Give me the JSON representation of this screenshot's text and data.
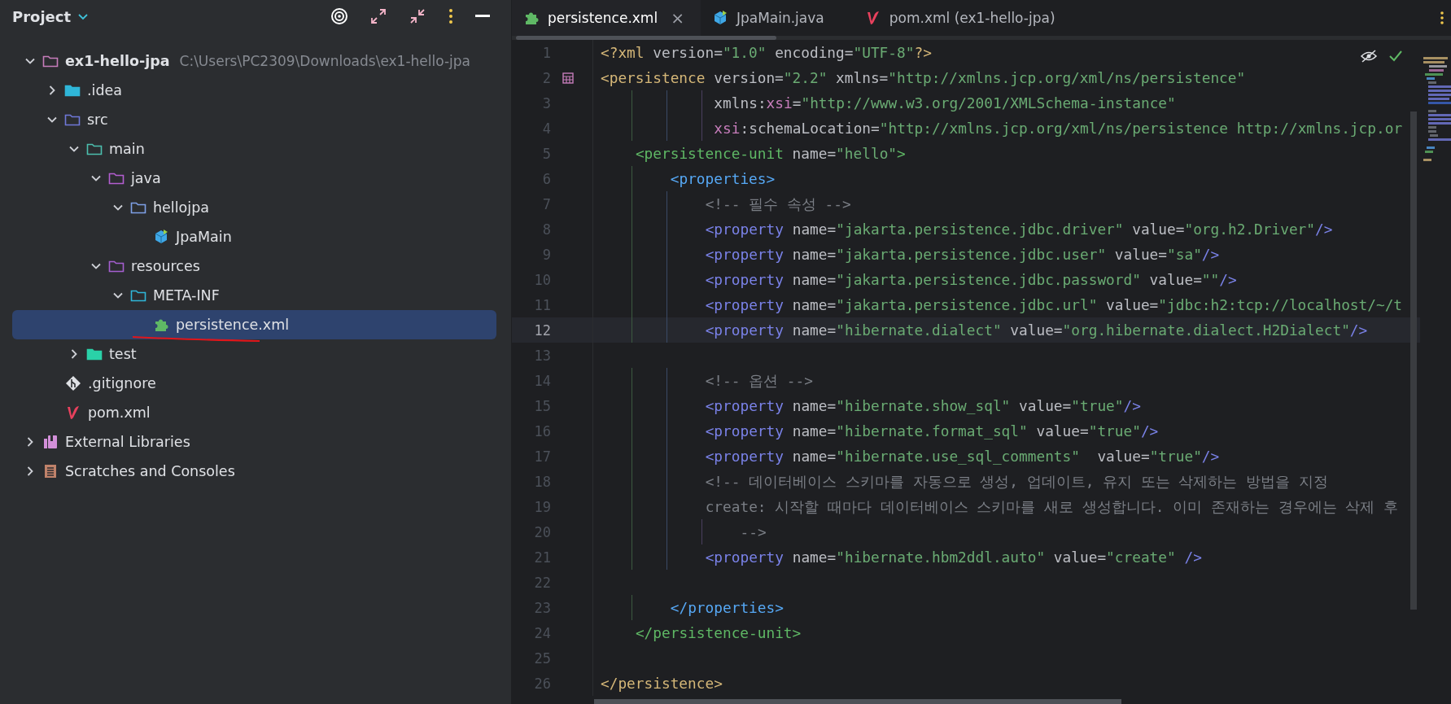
{
  "project_panel": {
    "title": "Project",
    "tree": [
      {
        "label": "ex1-hello-jpa",
        "kind": "module",
        "path": "C:\\Users\\PC2309\\Downloads\\ex1-hello-jpa",
        "expanded": true,
        "selected": false,
        "children": [
          {
            "label": ".idea",
            "kind": "idea",
            "expanded": false,
            "selected": false
          },
          {
            "label": "src",
            "kind": "source",
            "expanded": true,
            "selected": false,
            "children": [
              {
                "label": "main",
                "kind": "main",
                "expanded": true,
                "selected": false,
                "children": [
                  {
                    "label": "java",
                    "kind": "java-root",
                    "expanded": true,
                    "selected": false,
                    "children": [
                      {
                        "label": "hellojpa",
                        "kind": "package",
                        "expanded": true,
                        "selected": false,
                        "children": [
                          {
                            "label": "JpaMain",
                            "kind": "class",
                            "selected": false
                          }
                        ]
                      }
                    ]
                  },
                  {
                    "label": "resources",
                    "kind": "resources",
                    "expanded": true,
                    "selected": false,
                    "children": [
                      {
                        "label": "META-INF",
                        "kind": "meta",
                        "expanded": true,
                        "selected": false,
                        "children": [
                          {
                            "label": "persistence.xml",
                            "kind": "xml",
                            "selected": true
                          }
                        ]
                      }
                    ]
                  }
                ]
              },
              {
                "label": "test",
                "kind": "test",
                "expanded": false,
                "selected": false
              }
            ]
          },
          {
            "label": ".gitignore",
            "kind": "gitignore",
            "selected": false
          },
          {
            "label": "pom.xml",
            "kind": "maven",
            "selected": false
          }
        ]
      },
      {
        "label": "External Libraries",
        "kind": "libraries",
        "expanded": false,
        "selected": false
      },
      {
        "label": "Scratches and Consoles",
        "kind": "scratches",
        "expanded": false,
        "selected": false
      }
    ]
  },
  "editor": {
    "tabs": [
      {
        "label": "persistence.xml",
        "kind": "xml",
        "selected": true,
        "close": "×"
      },
      {
        "label": "JpaMain.java",
        "kind": "class",
        "selected": false
      },
      {
        "label": "pom.xml (ex1-hello-jpa)",
        "kind": "maven",
        "selected": false
      }
    ],
    "lines": [
      {
        "number": "1",
        "selected": false,
        "kind": "top",
        "tokens": [
          {
            "kind": "prolog",
            "text": "<?xml"
          },
          {
            "kind": "attr",
            "text": " version="
          },
          {
            "kind": "value",
            "text": "\"1.0\""
          },
          {
            "kind": "attr",
            "text": " encoding="
          },
          {
            "kind": "value",
            "text": "\"UTF-8\""
          },
          {
            "kind": "prolog",
            "text": "?>"
          }
        ]
      },
      {
        "number": "2",
        "selected": false,
        "kind": "top",
        "tokens": [
          {
            "kind": "tag-root",
            "text": "<persistence"
          },
          {
            "kind": "attr",
            "text": " version="
          },
          {
            "kind": "value",
            "text": "\"2.2\""
          },
          {
            "kind": "attr",
            "text": " xmlns="
          },
          {
            "kind": "value",
            "text": "\"http://xmlns.jcp.org/xml/ns/persistence\""
          }
        ]
      },
      {
        "number": "3",
        "selected": false,
        "kind": "aligned",
        "tokens": [
          {
            "kind": "attr",
            "text": "xmlns:"
          },
          {
            "kind": "ns",
            "text": "xsi"
          },
          {
            "kind": "attr",
            "text": "="
          },
          {
            "kind": "value",
            "text": "\"http://www.w3.org/2001/XMLSchema-instance\""
          }
        ]
      },
      {
        "number": "4",
        "selected": false,
        "kind": "aligned",
        "tokens": [
          {
            "kind": "ns",
            "text": "xsi"
          },
          {
            "kind": "attr",
            "text": ":schemaLocation="
          },
          {
            "kind": "value",
            "text": "\"http://xmlns.jcp.org/xml/ns/persistence http://xmlns.jcp.or"
          }
        ]
      },
      {
        "number": "5",
        "selected": false,
        "kind": "unit",
        "tokens": [
          {
            "kind": "tag-unit",
            "text": "<persistence-unit"
          },
          {
            "kind": "attr",
            "text": " name="
          },
          {
            "kind": "value",
            "text": "\"hello\""
          },
          {
            "kind": "tag-unit",
            "text": ">"
          }
        ]
      },
      {
        "number": "6",
        "selected": false,
        "kind": "properties",
        "tokens": [
          {
            "kind": "tag-props",
            "text": "<properties>"
          }
        ]
      },
      {
        "number": "7",
        "selected": false,
        "kind": "property",
        "tokens": [
          {
            "kind": "comment",
            "text": "<!-- 필수 속성 -->"
          }
        ]
      },
      {
        "number": "8",
        "selected": false,
        "kind": "property",
        "tokens": [
          {
            "kind": "tag-prop",
            "text": "<property"
          },
          {
            "kind": "attr",
            "text": " name="
          },
          {
            "kind": "value",
            "text": "\"jakarta.persistence.jdbc.driver\""
          },
          {
            "kind": "attr",
            "text": " value="
          },
          {
            "kind": "value",
            "text": "\"org.h2.Driver\""
          },
          {
            "kind": "tag-prop",
            "text": "/>"
          }
        ]
      },
      {
        "number": "9",
        "selected": false,
        "kind": "property",
        "tokens": [
          {
            "kind": "tag-prop",
            "text": "<property"
          },
          {
            "kind": "attr",
            "text": " name="
          },
          {
            "kind": "value",
            "text": "\"jakarta.persistence.jdbc.user\""
          },
          {
            "kind": "attr",
            "text": " value="
          },
          {
            "kind": "value",
            "text": "\"sa\""
          },
          {
            "kind": "tag-prop",
            "text": "/>"
          }
        ]
      },
      {
        "number": "10",
        "selected": false,
        "kind": "property",
        "tokens": [
          {
            "kind": "tag-prop",
            "text": "<property"
          },
          {
            "kind": "attr",
            "text": " name="
          },
          {
            "kind": "value",
            "text": "\"jakarta.persistence.jdbc.password\""
          },
          {
            "kind": "attr",
            "text": " value="
          },
          {
            "kind": "value",
            "text": "\"\""
          },
          {
            "kind": "tag-prop",
            "text": "/>"
          }
        ]
      },
      {
        "number": "11",
        "selected": false,
        "kind": "property",
        "tokens": [
          {
            "kind": "tag-prop",
            "text": "<property"
          },
          {
            "kind": "attr",
            "text": " name="
          },
          {
            "kind": "value",
            "text": "\"jakarta.persistence.jdbc.url\""
          },
          {
            "kind": "attr",
            "text": " value="
          },
          {
            "kind": "value",
            "text": "\"jdbc:h2:tcp://localhost/~/t"
          }
        ]
      },
      {
        "number": "12",
        "selected": true,
        "kind": "property",
        "tokens": [
          {
            "kind": "tag-prop",
            "text": "<property"
          },
          {
            "kind": "attr",
            "text": " name="
          },
          {
            "kind": "value",
            "text": "\"hibernate.dialect\""
          },
          {
            "kind": "attr",
            "text": " value="
          },
          {
            "kind": "value",
            "text": "\"org.hibernate.dialect.H2Dialect\""
          },
          {
            "kind": "tag-prop",
            "text": "/>"
          }
        ]
      },
      {
        "number": "13",
        "selected": false,
        "kind": "blank"
      },
      {
        "number": "14",
        "selected": false,
        "kind": "property",
        "tokens": [
          {
            "kind": "comment",
            "text": "<!-- 옵션 -->"
          }
        ]
      },
      {
        "number": "15",
        "selected": false,
        "kind": "property",
        "tokens": [
          {
            "kind": "tag-prop",
            "text": "<property"
          },
          {
            "kind": "attr",
            "text": " name="
          },
          {
            "kind": "value",
            "text": "\"hibernate.show_sql\""
          },
          {
            "kind": "attr",
            "text": " value="
          },
          {
            "kind": "value",
            "text": "\"true\""
          },
          {
            "kind": "tag-prop",
            "text": "/>"
          }
        ]
      },
      {
        "number": "16",
        "selected": false,
        "kind": "property",
        "tokens": [
          {
            "kind": "tag-prop",
            "text": "<property"
          },
          {
            "kind": "attr",
            "text": " name="
          },
          {
            "kind": "value",
            "text": "\"hibernate.format_sql\""
          },
          {
            "kind": "attr",
            "text": " value="
          },
          {
            "kind": "value",
            "text": "\"true\""
          },
          {
            "kind": "tag-prop",
            "text": "/>"
          }
        ]
      },
      {
        "number": "17",
        "selected": false,
        "kind": "property",
        "tokens": [
          {
            "kind": "tag-prop",
            "text": "<property"
          },
          {
            "kind": "attr",
            "text": " name="
          },
          {
            "kind": "value",
            "text": "\"hibernate.use_sql_comments\""
          },
          {
            "kind": "attr",
            "text": "  value="
          },
          {
            "kind": "value",
            "text": "\"true\""
          },
          {
            "kind": "tag-prop",
            "text": "/>"
          }
        ]
      },
      {
        "number": "18",
        "selected": false,
        "kind": "property",
        "tokens": [
          {
            "kind": "comment",
            "text": "<!-- 데이터베이스 스키마를 자동으로 생성, 업데이트, 유지 또는 삭제하는 방법을 지정"
          }
        ]
      },
      {
        "number": "19",
        "selected": false,
        "kind": "property",
        "tokens": [
          {
            "kind": "comment",
            "text": "create: 시작할 때마다 데이터베이스 스키마를 새로 생성합니다. 이미 존재하는 경우에는 삭제 후"
          }
        ]
      },
      {
        "number": "20",
        "selected": false,
        "kind": "continuation",
        "tokens": [
          {
            "kind": "comment",
            "text": "-->"
          }
        ]
      },
      {
        "number": "21",
        "selected": false,
        "kind": "property",
        "tokens": [
          {
            "kind": "tag-prop",
            "text": "<property"
          },
          {
            "kind": "attr",
            "text": " name="
          },
          {
            "kind": "value",
            "text": "\"hibernate.hbm2ddl.auto\""
          },
          {
            "kind": "attr",
            "text": " value="
          },
          {
            "kind": "value",
            "text": "\"create\""
          },
          {
            "kind": "tag-prop",
            "text": " />"
          }
        ]
      },
      {
        "number": "22",
        "selected": false,
        "kind": "blank"
      },
      {
        "number": "23",
        "selected": false,
        "kind": "properties",
        "tokens": [
          {
            "kind": "tag-props",
            "text": "</properties>"
          }
        ]
      },
      {
        "number": "24",
        "selected": false,
        "kind": "unit",
        "tokens": [
          {
            "kind": "tag-unit",
            "text": "</persistence-unit>"
          }
        ]
      },
      {
        "number": "25",
        "selected": false,
        "kind": "blank"
      },
      {
        "number": "26",
        "selected": false,
        "kind": "top",
        "tokens": [
          {
            "kind": "tag-root",
            "text": "</persistence>"
          }
        ]
      }
    ]
  }
}
